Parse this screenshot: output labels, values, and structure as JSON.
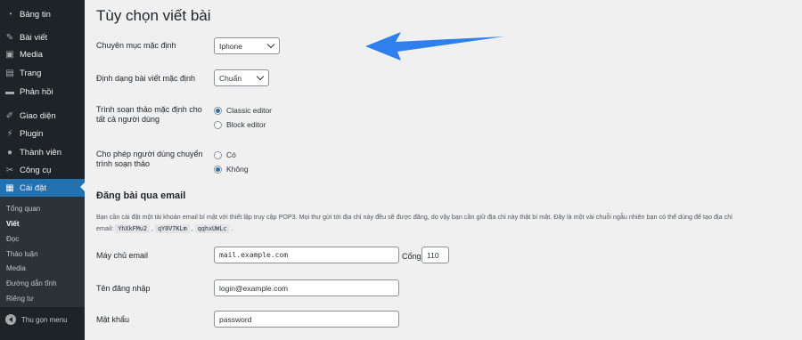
{
  "sidebar": {
    "items": [
      {
        "label": "Bảng tin",
        "icon": "dashboard-icon"
      },
      {
        "label": "Bài viết",
        "icon": "pin-icon"
      },
      {
        "label": "Media",
        "icon": "media-icon"
      },
      {
        "label": "Trang",
        "icon": "page-icon"
      },
      {
        "label": "Phản hồi",
        "icon": "comment-icon"
      },
      {
        "label": "Giao diện",
        "icon": "brush-icon"
      },
      {
        "label": "Plugin",
        "icon": "plugin-icon"
      },
      {
        "label": "Thành viên",
        "icon": "user-icon"
      },
      {
        "label": "Công cụ",
        "icon": "wrench-icon"
      },
      {
        "label": "Cài đặt",
        "icon": "settings-icon"
      }
    ],
    "submenu": [
      "Tổng quan",
      "Viết",
      "Đọc",
      "Thảo luận",
      "Media",
      "Đường dẫn tĩnh",
      "Riêng tư"
    ],
    "collapse_label": "Thu gọn menu"
  },
  "page": {
    "title": "Tùy chọn viết bài",
    "default_category": {
      "label": "Chuyên mục mặc định",
      "value": "Iphone"
    },
    "default_format": {
      "label": "Định dạng bài viết mặc định",
      "value": "Chuẩn"
    },
    "default_editor": {
      "label": "Trình soạn thảo mặc định cho tất cả người dùng",
      "options": [
        "Classic editor",
        "Block editor"
      ],
      "selected": "Classic editor"
    },
    "allow_switch": {
      "label": "Cho phép người dùng chuyển trình soạn thảo",
      "options": [
        "Có",
        "Không"
      ],
      "selected": "Không"
    },
    "email_section": {
      "title": "Đăng bài qua email",
      "desc_main": "Bạn cần cài đặt một tài khoản email bí mật với thiết lập truy cập POP3. Mọi thư gửi tới địa chỉ này đều sẽ được đăng, do vậy bạn cần giữ địa chỉ này thật bí mật. Đây là một vài chuỗi ngẫu nhiên bạn có thể dùng để tạo địa chỉ",
      "desc_email_word": "email:",
      "random_strings": [
        "YhXkFMu2",
        "qY0V7KLm",
        "qqhxUWLc"
      ],
      "mail_server": {
        "label": "Máy chủ email",
        "value": "mail.example.com",
        "port_label": "Cổng",
        "port_value": "110"
      },
      "username": {
        "label": "Tên đăng nhập",
        "value": "login@example.com"
      },
      "password": {
        "label": "Mật khẩu",
        "value": "password"
      }
    }
  },
  "colors": {
    "sidebar_bg": "#1d2327",
    "accent": "#2271b1",
    "annotation_arrow": "#2f80ed"
  }
}
